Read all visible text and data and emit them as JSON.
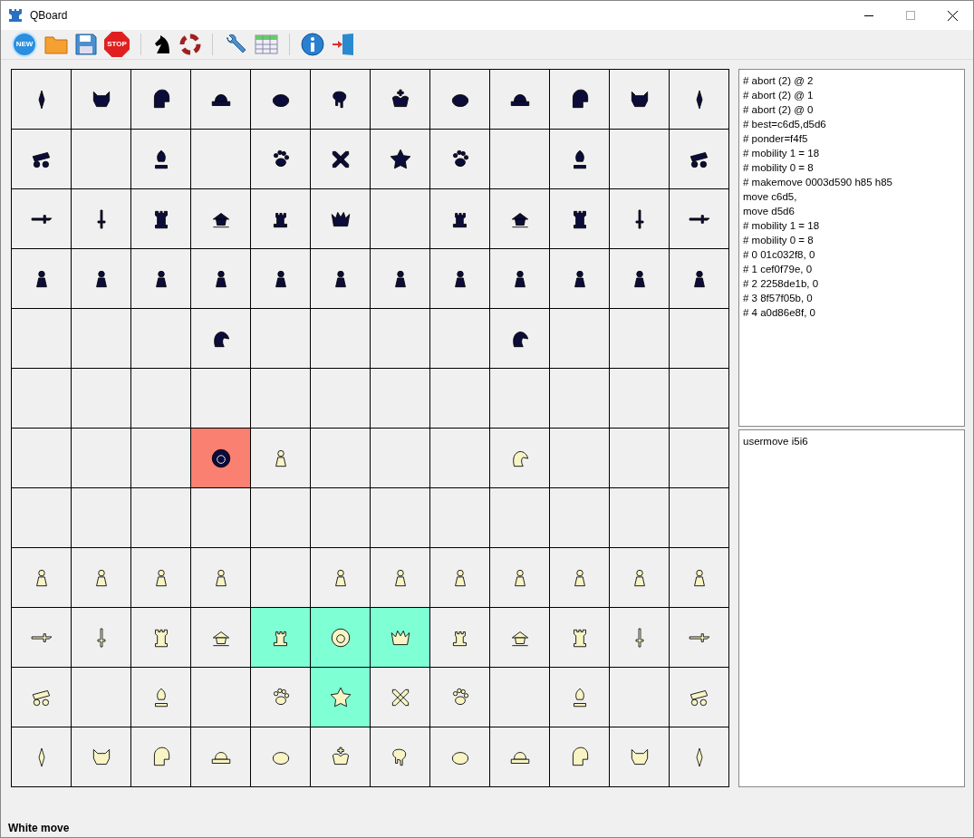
{
  "window": {
    "title": "QBoard"
  },
  "toolbar": [
    {
      "kind": "new",
      "label": "NEW"
    },
    {
      "kind": "open"
    },
    {
      "kind": "save"
    },
    {
      "kind": "stop",
      "label": "STOP"
    },
    {
      "kind": "separator"
    },
    {
      "kind": "knight"
    },
    {
      "kind": "lifebuoy"
    },
    {
      "kind": "separator"
    },
    {
      "kind": "wrench"
    },
    {
      "kind": "table"
    },
    {
      "kind": "separator"
    },
    {
      "kind": "info"
    },
    {
      "kind": "exit"
    }
  ],
  "board": {
    "rows": [
      [
        {
          "kind": "spear",
          "black": true
        },
        {
          "kind": "cat",
          "black": true
        },
        {
          "kind": "helmet",
          "black": true
        },
        {
          "kind": "hat",
          "black": true
        },
        {
          "kind": "turban",
          "black": true
        },
        {
          "kind": "elephant",
          "black": true
        },
        {
          "kind": "king",
          "black": true
        },
        {
          "kind": "turban",
          "black": true
        },
        {
          "kind": "hat",
          "black": true
        },
        {
          "kind": "helmet",
          "black": true
        },
        {
          "kind": "cat",
          "black": true
        },
        {
          "kind": "spear",
          "black": true
        }
      ],
      [
        {
          "kind": "cannon",
          "black": true
        },
        {
          "kind": "empty"
        },
        {
          "kind": "bishop",
          "black": true
        },
        {
          "kind": "empty"
        },
        {
          "kind": "paw",
          "black": true
        },
        {
          "kind": "swords",
          "black": true
        },
        {
          "kind": "star",
          "black": true
        },
        {
          "kind": "paw",
          "black": true
        },
        {
          "kind": "empty"
        },
        {
          "kind": "bishop",
          "black": true
        },
        {
          "kind": "empty"
        },
        {
          "kind": "cannon",
          "black": true
        }
      ],
      [
        {
          "kind": "sword",
          "black": true
        },
        {
          "kind": "dagger",
          "black": true
        },
        {
          "kind": "rook",
          "black": true
        },
        {
          "kind": "general",
          "black": true
        },
        {
          "kind": "tower",
          "black": true
        },
        {
          "kind": "queen",
          "black": true
        },
        {
          "kind": "empty"
        },
        {
          "kind": "tower",
          "black": true
        },
        {
          "kind": "general",
          "black": true
        },
        {
          "kind": "rook",
          "black": true
        },
        {
          "kind": "dagger",
          "black": true
        },
        {
          "kind": "sword",
          "black": true
        }
      ],
      [
        {
          "kind": "pawn",
          "black": true
        },
        {
          "kind": "pawn",
          "black": true
        },
        {
          "kind": "pawn",
          "black": true
        },
        {
          "kind": "pawn",
          "black": true
        },
        {
          "kind": "pawn",
          "black": true
        },
        {
          "kind": "pawn",
          "black": true
        },
        {
          "kind": "pawn",
          "black": true
        },
        {
          "kind": "pawn",
          "black": true
        },
        {
          "kind": "pawn",
          "black": true
        },
        {
          "kind": "pawn",
          "black": true
        },
        {
          "kind": "pawn",
          "black": true
        },
        {
          "kind": "pawn",
          "black": true
        }
      ],
      [
        {
          "kind": "empty"
        },
        {
          "kind": "empty"
        },
        {
          "kind": "empty"
        },
        {
          "kind": "eagle",
          "black": true
        },
        {
          "kind": "empty"
        },
        {
          "kind": "empty"
        },
        {
          "kind": "empty"
        },
        {
          "kind": "empty"
        },
        {
          "kind": "eagle",
          "black": true
        },
        {
          "kind": "empty"
        },
        {
          "kind": "empty"
        },
        {
          "kind": "empty"
        }
      ],
      [
        {
          "kind": "empty"
        },
        {
          "kind": "empty"
        },
        {
          "kind": "empty"
        },
        {
          "kind": "empty"
        },
        {
          "kind": "empty"
        },
        {
          "kind": "empty"
        },
        {
          "kind": "empty"
        },
        {
          "kind": "empty"
        },
        {
          "kind": "empty"
        },
        {
          "kind": "empty"
        },
        {
          "kind": "empty"
        },
        {
          "kind": "empty"
        }
      ],
      [
        {
          "kind": "empty"
        },
        {
          "kind": "empty"
        },
        {
          "kind": "empty"
        },
        {
          "kind": "lion",
          "black": true,
          "color": "#fa8072"
        },
        {
          "kind": "pawn",
          "black": false
        },
        {
          "kind": "empty"
        },
        {
          "kind": "empty"
        },
        {
          "kind": "empty"
        },
        {
          "kind": "eagle",
          "black": false
        },
        {
          "kind": "empty"
        },
        {
          "kind": "empty"
        },
        {
          "kind": "empty"
        }
      ],
      [
        {
          "kind": "empty"
        },
        {
          "kind": "empty"
        },
        {
          "kind": "empty"
        },
        {
          "kind": "empty"
        },
        {
          "kind": "empty"
        },
        {
          "kind": "empty"
        },
        {
          "kind": "empty"
        },
        {
          "kind": "empty"
        },
        {
          "kind": "empty"
        },
        {
          "kind": "empty"
        },
        {
          "kind": "empty"
        },
        {
          "kind": "empty"
        }
      ],
      [
        {
          "kind": "pawn",
          "black": false
        },
        {
          "kind": "pawn",
          "black": false
        },
        {
          "kind": "pawn",
          "black": false
        },
        {
          "kind": "pawn",
          "black": false
        },
        {
          "kind": "empty"
        },
        {
          "kind": "pawn",
          "black": false
        },
        {
          "kind": "pawn",
          "black": false
        },
        {
          "kind": "pawn",
          "black": false
        },
        {
          "kind": "pawn",
          "black": false
        },
        {
          "kind": "pawn",
          "black": false
        },
        {
          "kind": "pawn",
          "black": false
        },
        {
          "kind": "pawn",
          "black": false
        }
      ],
      [
        {
          "kind": "sword",
          "black": false
        },
        {
          "kind": "dagger",
          "black": false
        },
        {
          "kind": "rook",
          "black": false
        },
        {
          "kind": "general",
          "black": false
        },
        {
          "kind": "tower",
          "black": false,
          "color": "#7fffd4"
        },
        {
          "kind": "lion",
          "black": false,
          "color": "#7fffd4"
        },
        {
          "kind": "queen",
          "black": false,
          "color": "#7fffd4"
        },
        {
          "kind": "tower",
          "black": false
        },
        {
          "kind": "general",
          "black": false
        },
        {
          "kind": "rook",
          "black": false
        },
        {
          "kind": "dagger",
          "black": false
        },
        {
          "kind": "sword",
          "black": false
        }
      ],
      [
        {
          "kind": "cannon",
          "black": false
        },
        {
          "kind": "empty"
        },
        {
          "kind": "bishop",
          "black": false
        },
        {
          "kind": "empty"
        },
        {
          "kind": "paw",
          "black": false
        },
        {
          "kind": "star",
          "black": false,
          "color": "#7fffd4"
        },
        {
          "kind": "swords",
          "black": false
        },
        {
          "kind": "paw",
          "black": false
        },
        {
          "kind": "empty"
        },
        {
          "kind": "bishop",
          "black": false
        },
        {
          "kind": "empty"
        },
        {
          "kind": "cannon",
          "black": false
        }
      ],
      [
        {
          "kind": "spear",
          "black": false
        },
        {
          "kind": "cat",
          "black": false
        },
        {
          "kind": "helmet",
          "black": false
        },
        {
          "kind": "hat",
          "black": false
        },
        {
          "kind": "turban",
          "black": false
        },
        {
          "kind": "king",
          "black": false
        },
        {
          "kind": "elephant",
          "black": false
        },
        {
          "kind": "turban",
          "black": false
        },
        {
          "kind": "hat",
          "black": false
        },
        {
          "kind": "helmet",
          "black": false
        },
        {
          "kind": "cat",
          "black": false
        },
        {
          "kind": "spear",
          "black": false
        }
      ]
    ]
  },
  "engine_log": [
    "# abort (2) @ 2",
    "# abort (2) @ 1",
    "# abort (2) @ 0",
    "# best=c6d5,d5d6",
    "# ponder=f4f5",
    "# mobility 1 = 18",
    "# mobility 0 = 8",
    "# makemove 0003d590 h85 h85",
    "move c6d5,",
    "move d5d6",
    "# mobility 1 = 18",
    "# mobility 0 = 8",
    "# 0 01c032f8, 0",
    "# 1 cef0f79e, 0",
    "# 2 2258de1b, 0",
    "# 3 8f57f05b, 0",
    "# 4 a0d86e8f, 0"
  ],
  "command_log": [
    "usermove i5i6"
  ],
  "status_bar": "White move"
}
